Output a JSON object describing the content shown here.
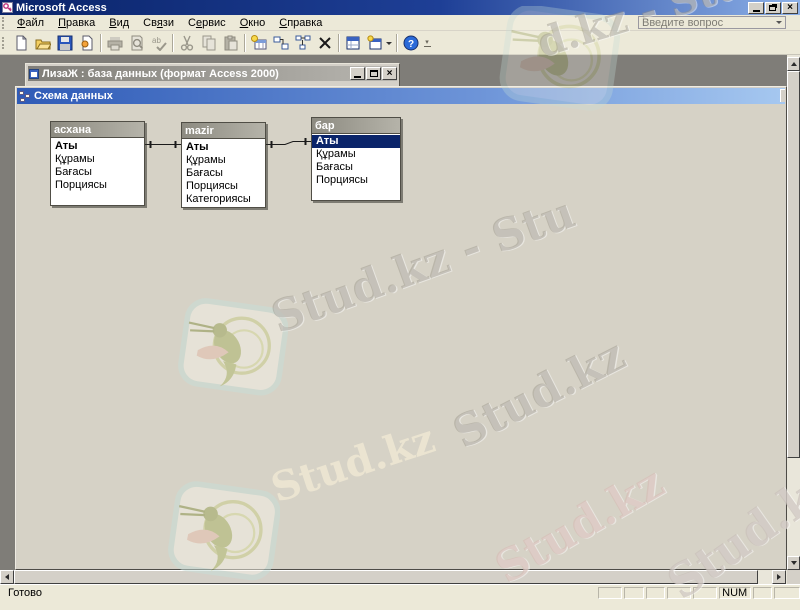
{
  "window": {
    "title": "Microsoft Access"
  },
  "ask_box": {
    "placeholder": "Введите вопрос"
  },
  "menu": {
    "items": [
      {
        "label": "Файл",
        "u": 0
      },
      {
        "label": "Правка",
        "u": 0
      },
      {
        "label": "Вид",
        "u": 0
      },
      {
        "label": "Связи",
        "u": 2
      },
      {
        "label": "Сервис",
        "u": 1
      },
      {
        "label": "Окно",
        "u": 0
      },
      {
        "label": "Справка",
        "u": 0
      }
    ]
  },
  "toolbar": {
    "buttons": [
      "new",
      "open",
      "save",
      "file-search",
      "print",
      "print-preview",
      "spelling",
      "cut",
      "copy",
      "paste",
      "show-table",
      "direct-relationships",
      "all-relationships",
      "delete",
      "database-window",
      "new-object",
      "help"
    ]
  },
  "db_window": {
    "title": "ЛизаЖ : база данных (формат Access 2000)"
  },
  "rel_window": {
    "title": "Схема данных",
    "tables": [
      {
        "name": "асхана",
        "fields": [
          "Аты",
          "Құрамы",
          "Бағасы",
          "Порциясы"
        ],
        "primary_key": "Аты"
      },
      {
        "name": "mazir",
        "fields": [
          "Аты",
          "Құрамы",
          "Бағасы",
          "Порциясы",
          "Категориясы"
        ],
        "primary_key": "Аты"
      },
      {
        "name": "бар",
        "fields": [
          "Аты",
          "Құрамы",
          "Бағасы",
          "Порциясы"
        ],
        "primary_key": "Аты",
        "selected_field": "Аты"
      }
    ],
    "relations": [
      {
        "from_table": "асхана",
        "from_field": "Аты",
        "to_table": "mazir",
        "to_field": "Аты"
      },
      {
        "from_table": "mazir",
        "from_field": "Аты",
        "to_table": "бар",
        "to_field": "Аты"
      }
    ]
  },
  "status_bar": {
    "ready": "Готово",
    "num_lock": "NUM"
  },
  "watermark": {
    "brand": "Stud.kz",
    "texts": [
      "d.kz - Stud.kz",
      "Stud.kz - Stu",
      "Stud.kz",
      "Stud.kz",
      "Stud.kz",
      "Stud.kz"
    ]
  },
  "colors": {
    "titlebar_active": "#0a246a",
    "titlebar_inactive": "#807e78",
    "workspace": "#7f7d78",
    "canvas": "#d6d2c6",
    "selection": "#0a246a",
    "face": "#ece9d8"
  }
}
